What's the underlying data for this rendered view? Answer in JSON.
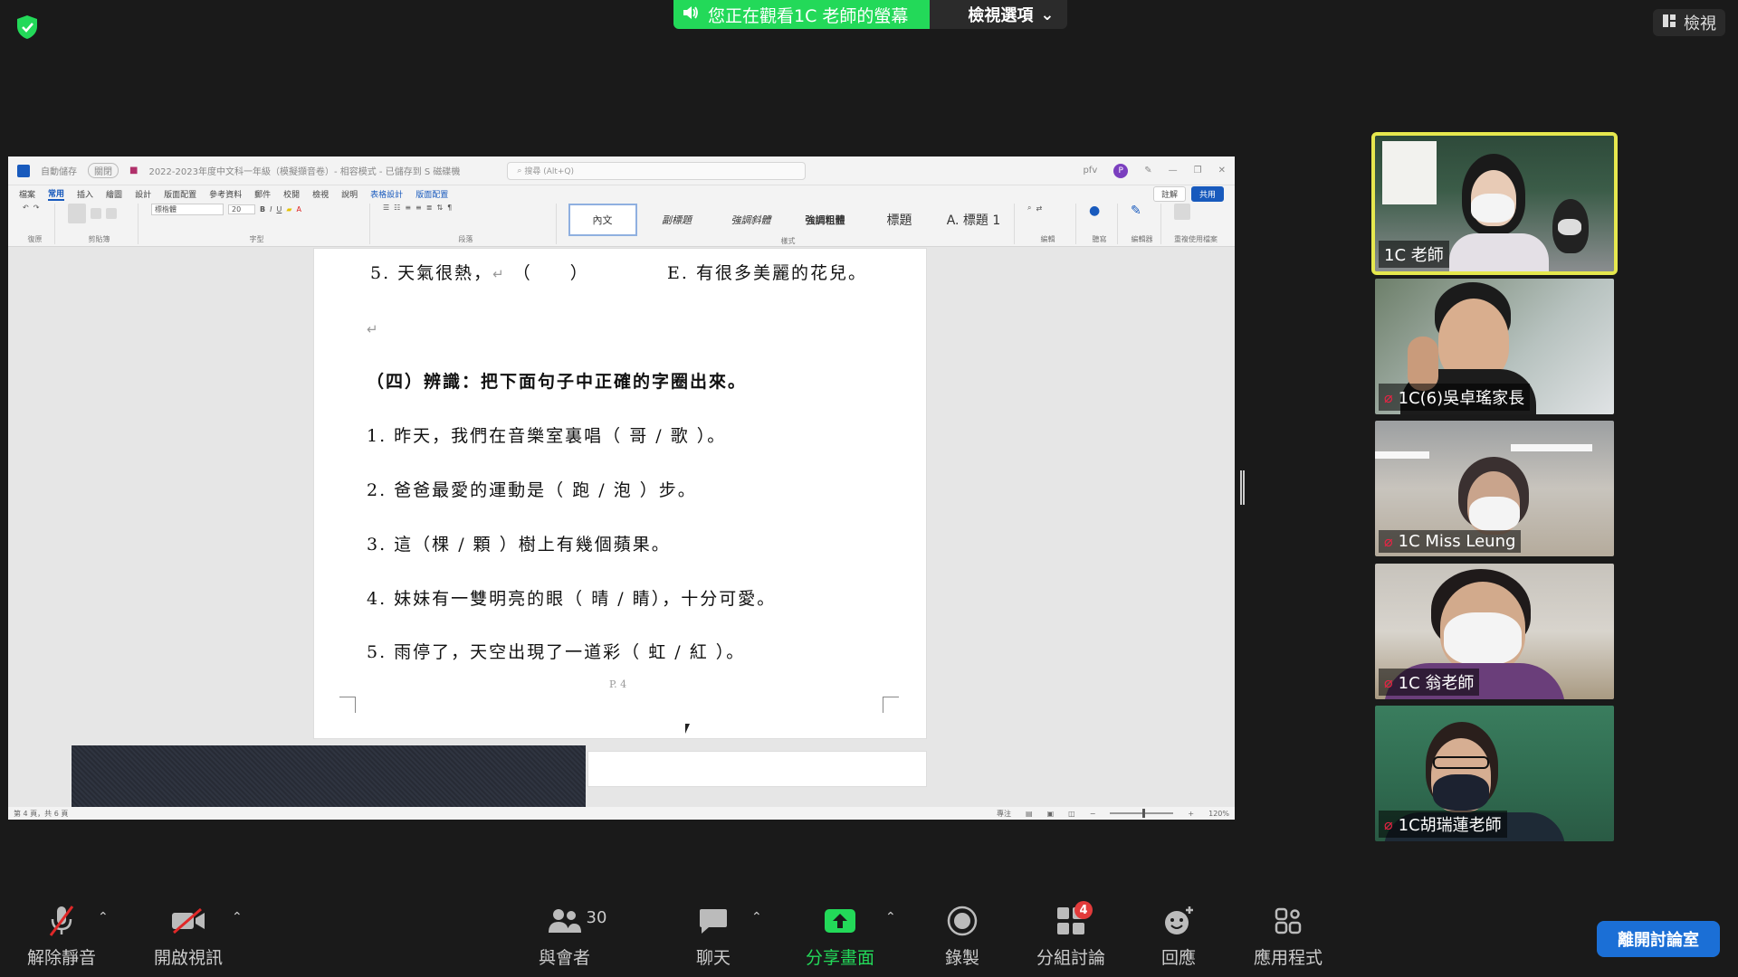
{
  "share_banner": {
    "text": "您正在觀看1C 老師的螢幕",
    "view_options": "檢視選項"
  },
  "view_button": "檢視",
  "word": {
    "title_left": "自動儲存",
    "toggle": "關閉",
    "doc_title": "2022-2023年度中文科一年級（模擬擷音卷）- 相容模式 - 已儲存到 S 磁碟機",
    "search": "搜尋 (Alt+Q)",
    "user": "pfv",
    "user_initial": "P",
    "tabs": [
      "檔案",
      "常用",
      "插入",
      "繪圖",
      "設計",
      "版面配置",
      "參考資料",
      "郵件",
      "校閱",
      "檢視",
      "說明",
      "表格設計",
      "版面配置"
    ],
    "comment_btn": "註解",
    "share_btn": "共用",
    "group_labels": [
      "復原",
      "剪貼簿",
      "字型",
      "段落",
      "樣式",
      "編輯",
      "聽寫",
      "編輯器",
      "重複使用檔案"
    ],
    "font_name": "標楷體",
    "font_size": "20",
    "styles": [
      "內文",
      "副標題",
      "強調斜體",
      "強調粗體",
      "標題",
      "A. 標題 1"
    ],
    "lines": {
      "l1_left": "5. 天氣很熱，",
      "l1_paren": "（　　）",
      "l1_right": "E. 有很多美麗的花兒。",
      "heading": "（四）辨識：把下面句子中正確的字圈出來。",
      "q1": "1.  昨天，我們在音樂室裏唱（ 哥 / 歌 ）。",
      "q2": "2.  爸爸最愛的運動是（ 跑 / 泡 ）步。",
      "q3": "3.  這（棵 / 顆 ）樹上有幾個蘋果。",
      "q4": "4.  妹妹有一雙明亮的眼（ 晴 / 睛），十分可愛。",
      "q5": "5.  雨停了，天空出現了一道彩（ 虹 / 紅 ）。",
      "page_num": "P. 4"
    },
    "status_left": "第 4 頁，共 6 頁",
    "status_focus": "專注",
    "zoom": "120%"
  },
  "participants": [
    {
      "name": "1C 老師",
      "muted": false
    },
    {
      "name": "1C(6)吳卓瑤家長",
      "muted": true
    },
    {
      "name": "1C Miss Leung",
      "muted": true
    },
    {
      "name": "1C 翁老師",
      "muted": true
    },
    {
      "name": "1C胡瑞蓮老師",
      "muted": true
    }
  ],
  "toolbar": {
    "unmute": "解除靜音",
    "start_video": "開啟視訊",
    "participants": "與會者",
    "participants_count": "30",
    "chat": "聊天",
    "share": "分享畫面",
    "record": "錄製",
    "breakout": "分組討論",
    "breakout_badge": "4",
    "reactions": "回應",
    "apps": "應用程式",
    "leave": "離開討論室"
  },
  "colors": {
    "zoom_green": "#23d959",
    "leave_blue": "#1b6fd6",
    "speaker_outline": "#e6e84e",
    "word_blue": "#185abd"
  }
}
